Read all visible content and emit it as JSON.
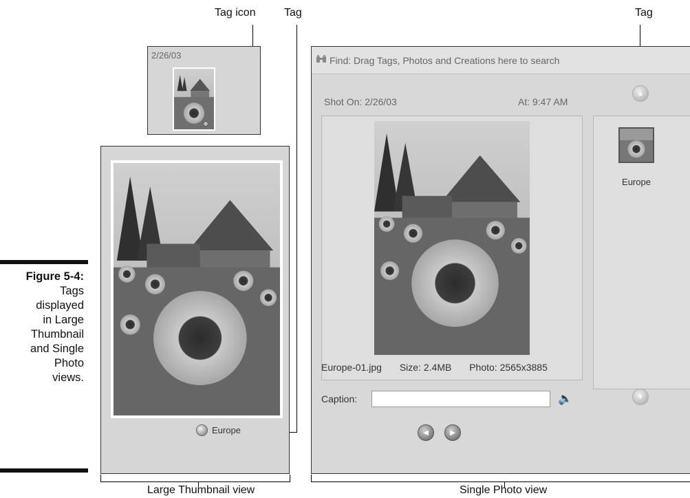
{
  "callouts": {
    "tag_icon": "Tag icon",
    "tag_left": "Tag",
    "tag_right": "Tag"
  },
  "figure": {
    "label": "Figure 5-4:",
    "text_lines": [
      "Tags",
      "displayed",
      "in Large",
      "Thumbnail",
      "and Single",
      "Photo",
      "views."
    ]
  },
  "small_thumbnail": {
    "date": "2/26/03"
  },
  "large_thumbnail": {
    "tag_label": "Europe"
  },
  "single_photo": {
    "find_bar": "Find: Drag Tags, Photos and Creations here to search",
    "shot_on": "Shot On: 2/26/03",
    "shot_at": "At: 9:47 AM",
    "filename": "Europe-01.jpg",
    "size": "Size: 2.4MB",
    "photo_dims": "Photo: 2565x3885",
    "caption_label": "Caption:",
    "caption_value": "",
    "tag_label": "Europe"
  },
  "bottom_labels": {
    "large": "Large Thumbnail view",
    "single": "Single Photo view"
  },
  "icons": {
    "find": "binoculars-icon",
    "speaker": "speaker-icon",
    "prev": "previous-icon",
    "next": "next-icon",
    "up": "scroll-up-icon",
    "down": "scroll-down-icon",
    "tag": "tag-icon"
  }
}
